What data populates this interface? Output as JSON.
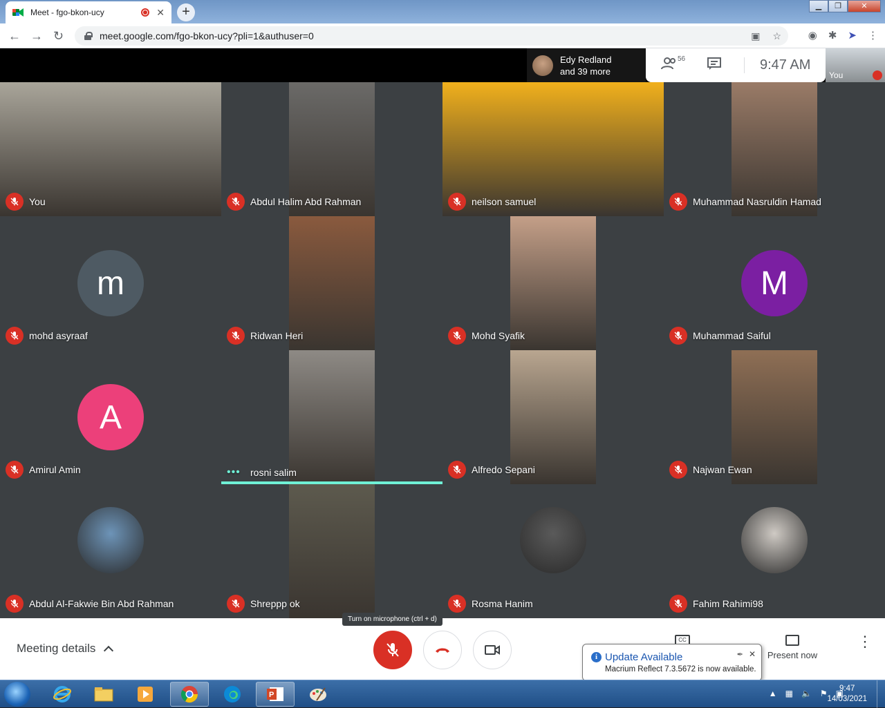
{
  "browser": {
    "tab_title": "Meet - fgo-bkon-ucy",
    "tab_close": "✕",
    "new_tab": "+",
    "url": "meet.google.com/fgo-bkon-ucy?pli=1&authuser=0",
    "window_buttons": [
      "▁",
      "❐",
      "✕"
    ]
  },
  "meet_top": {
    "speaker_name": "Edy Redland",
    "speaker_more": "and 39 more",
    "people_count": "56",
    "clock": "9:47 AM",
    "self_label": "You"
  },
  "participants": [
    {
      "name": "You",
      "muted": true,
      "type": "video",
      "bg": "#a9a59a"
    },
    {
      "name": "Abdul Halim Abd Rahman",
      "muted": true,
      "type": "video",
      "bg": "#6b6a68"
    },
    {
      "name": "neilson samuel",
      "muted": true,
      "type": "video",
      "bg": "#f1b01c"
    },
    {
      "name": "Muhammad Nasruldin Hamad",
      "muted": true,
      "type": "video",
      "bg": "#9a7b67"
    },
    {
      "name": "mohd asyraaf",
      "muted": true,
      "type": "avatar",
      "letter": "m",
      "color": "#4e5a63"
    },
    {
      "name": "Ridwan Heri",
      "muted": true,
      "type": "video",
      "bg": "#8a5a3e"
    },
    {
      "name": "Mohd Syafik",
      "muted": true,
      "type": "video",
      "bg": "#c49f88"
    },
    {
      "name": "Muhammad Saiful",
      "muted": true,
      "type": "avatar",
      "letter": "M",
      "color": "#7b1fa2"
    },
    {
      "name": "Amirul Amin",
      "muted": true,
      "type": "avatar",
      "letter": "A",
      "color": "#ec407a"
    },
    {
      "name": "rosni salim",
      "muted": false,
      "speaking": true,
      "type": "video",
      "bg": "#8e8a85"
    },
    {
      "name": "Alfredo Sepani",
      "muted": true,
      "type": "video",
      "bg": "#b9a690"
    },
    {
      "name": "Najwan Ewan",
      "muted": true,
      "type": "video",
      "bg": "#8f6f55"
    },
    {
      "name": "Abdul Al-Fakwie Bin Abd Rahman",
      "muted": true,
      "type": "photo",
      "bg": "#6d94b8"
    },
    {
      "name": "Shreppp ok",
      "muted": true,
      "type": "video",
      "bg": "#5d5a4e"
    },
    {
      "name": "Rosma Hanim",
      "muted": true,
      "type": "photo",
      "bg": "#5a5a5a"
    },
    {
      "name": "Fahim Rahimi98",
      "muted": true,
      "type": "photo",
      "bg": "#cfcac4"
    }
  ],
  "bottom": {
    "meeting_details": "Meeting details",
    "mic_tooltip": "Turn on microphone (ctrl + d)",
    "present_now": "Present now",
    "cc_text": "CC"
  },
  "notification": {
    "title": "Update Available",
    "body": "Macrium Reflect 7.3.5672 is now available.",
    "close": "✕"
  },
  "taskbar": {
    "time": "9:47",
    "date": "14/03/2021"
  }
}
